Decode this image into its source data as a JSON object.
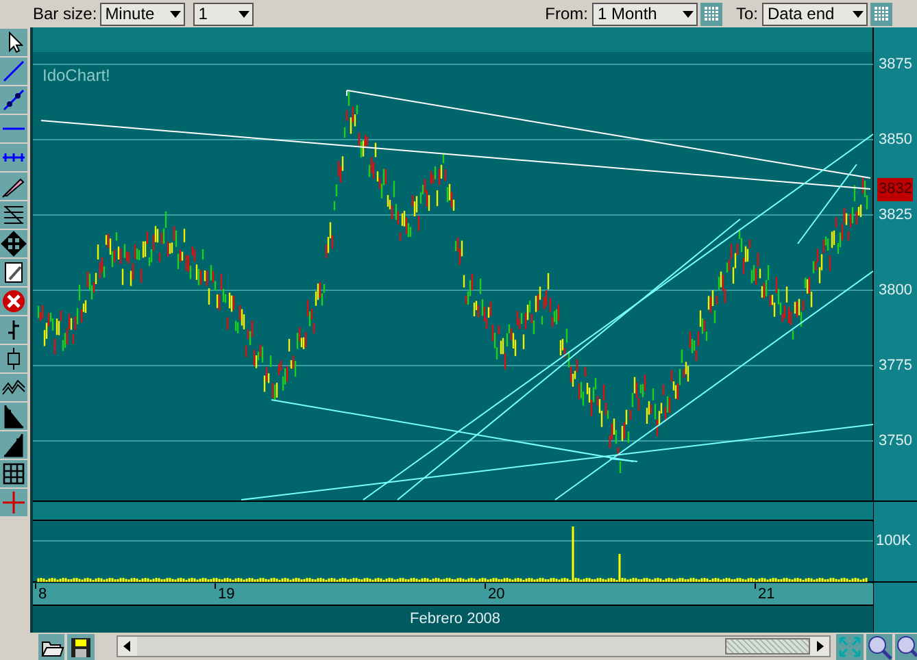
{
  "toolbar": {
    "bar_size_label": "Bar size:",
    "bar_size_unit": "Minute",
    "bar_size_count": "1",
    "from_label": "From:",
    "from_value": "1 Month",
    "to_label": "To:",
    "to_value": "Data end"
  },
  "chart": {
    "brand": "IdoChart!",
    "price_ticks": [
      "3875",
      "3850",
      "3825",
      "3800",
      "3775",
      "3750"
    ],
    "last_price": "3832",
    "volume_tick": "100K",
    "date_ticks": [
      "8",
      "19",
      "20",
      "21"
    ],
    "month_label": "Febrero 2008"
  }
}
